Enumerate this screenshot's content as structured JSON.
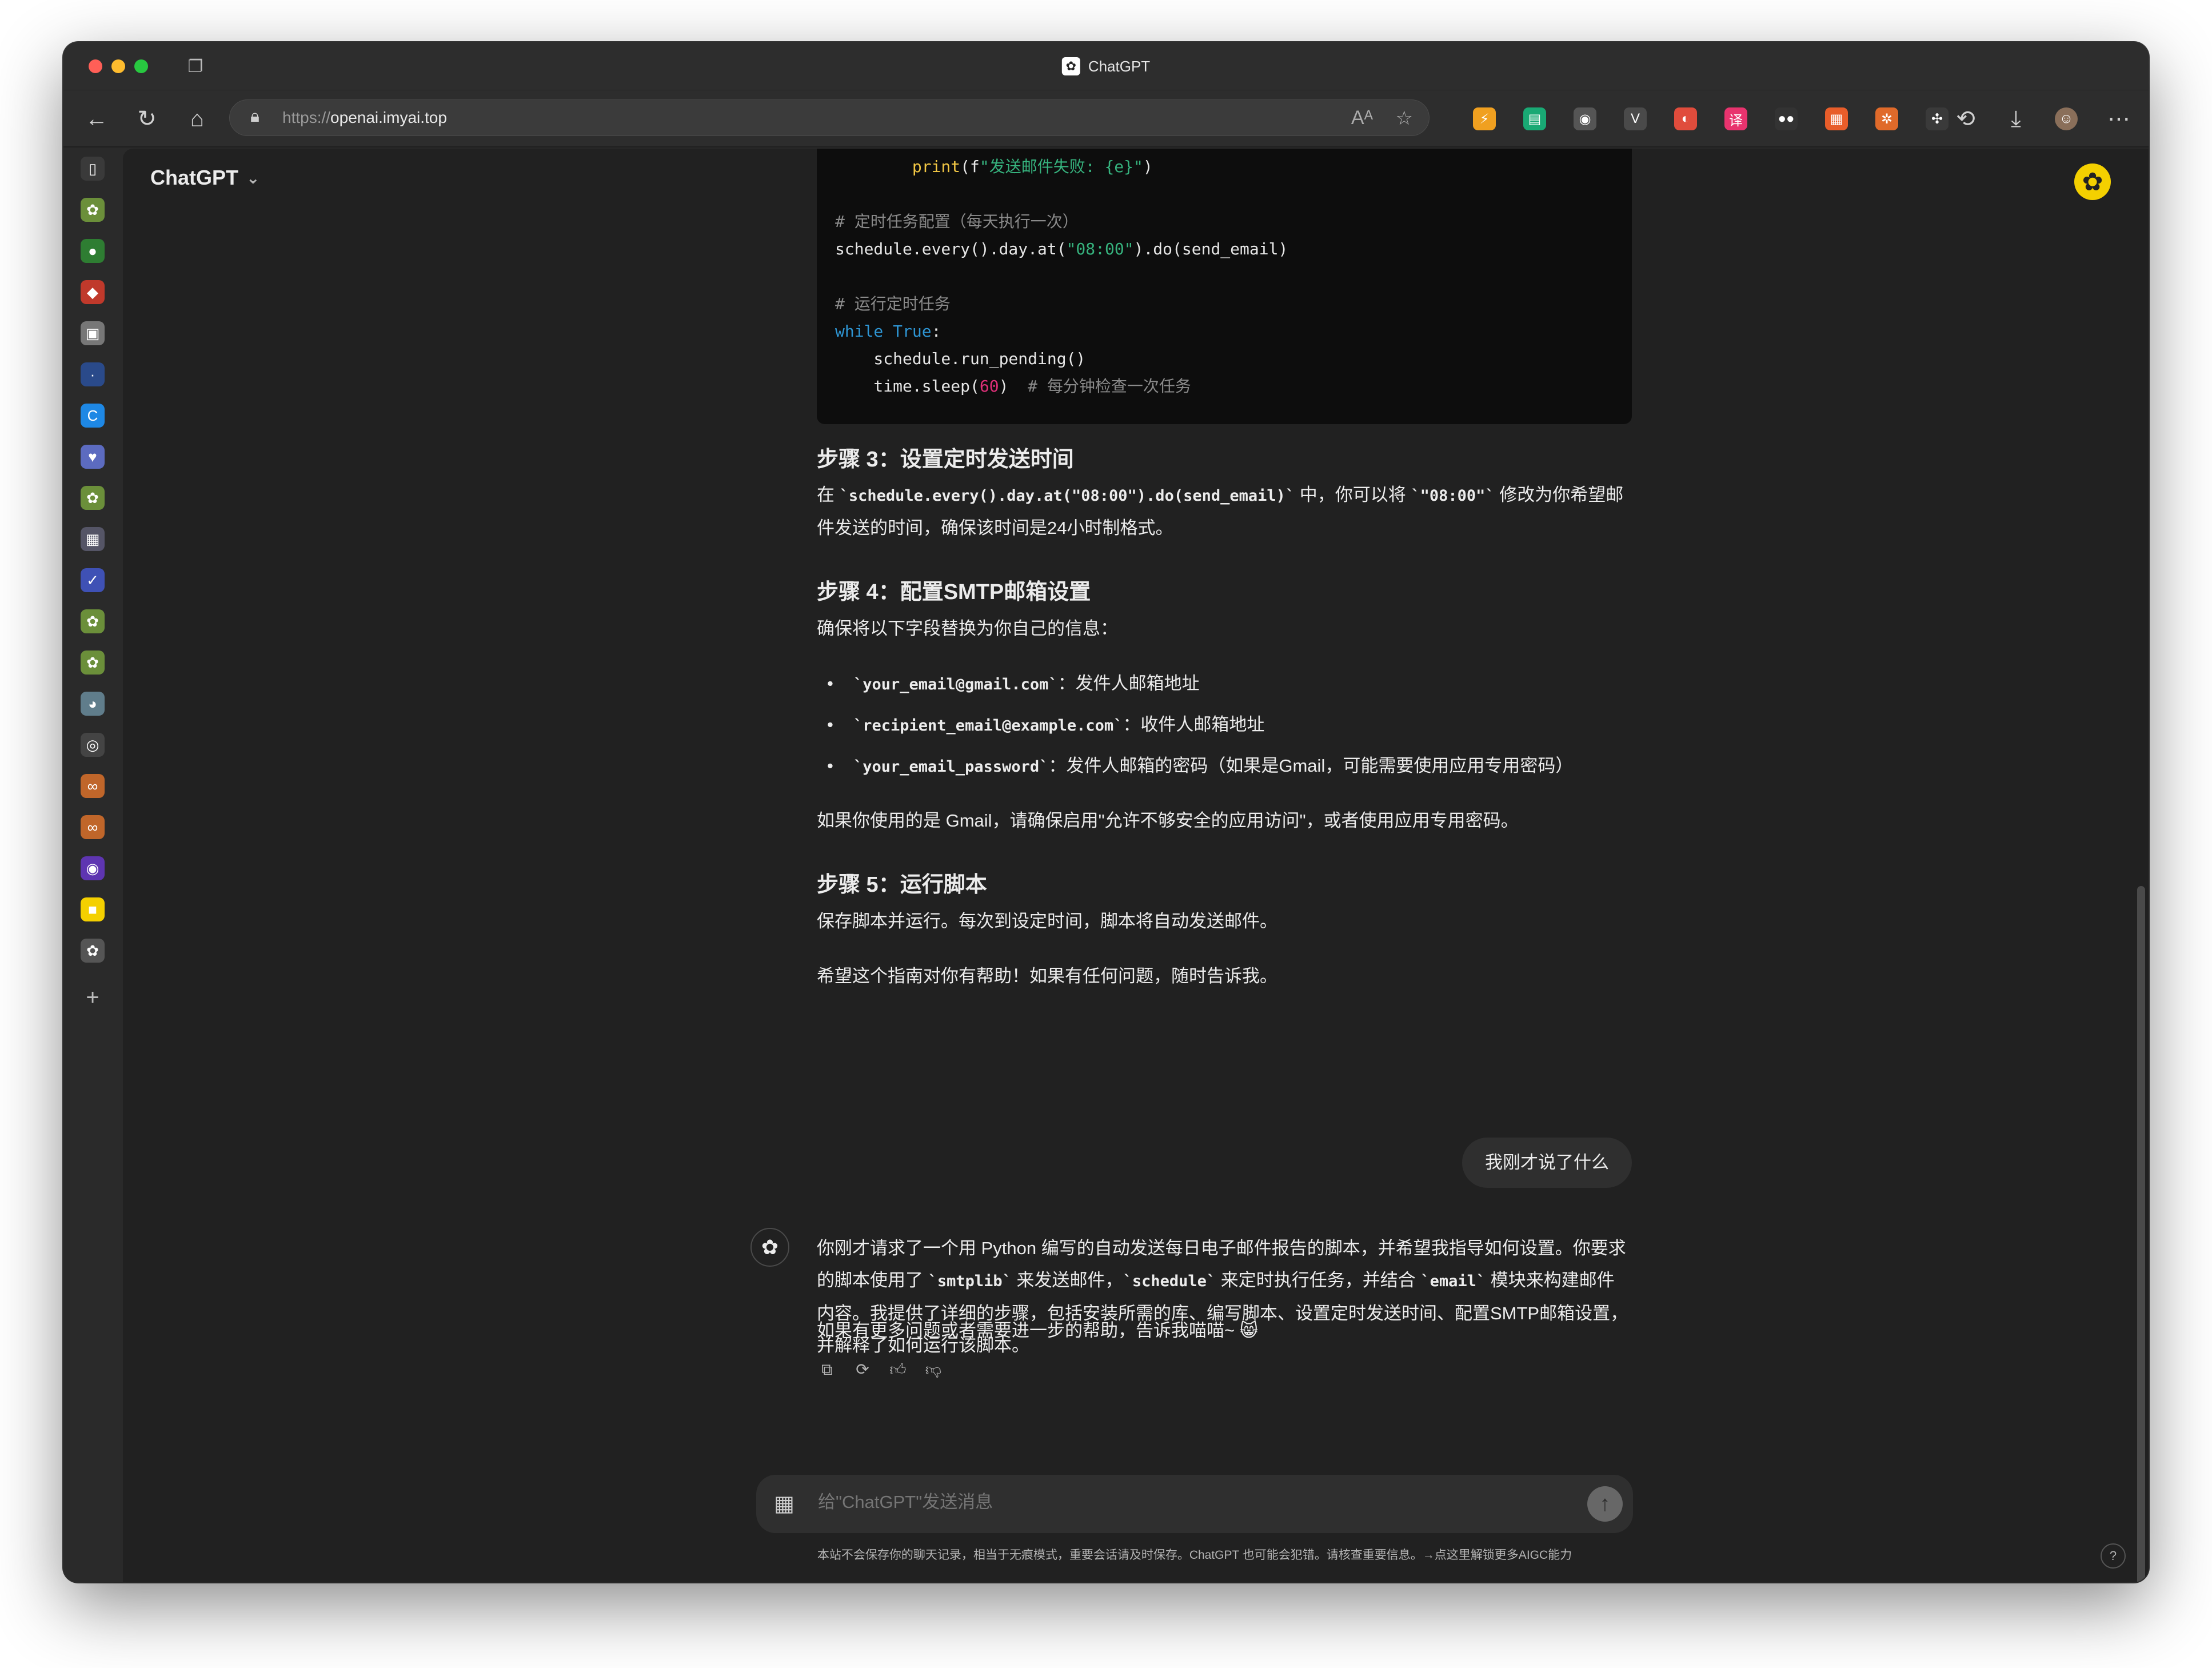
{
  "browser": {
    "tab_title": "ChatGPT",
    "url_scheme": "https://",
    "url_host": "openai.imyai.top",
    "traffic_colors": [
      "#ff5f57",
      "#febc2e",
      "#28c840"
    ]
  },
  "extensions": [
    {
      "icon": "ext-orange-icon",
      "color": "#f0a020",
      "glyph": "⚡"
    },
    {
      "icon": "ext-green-icon",
      "color": "#19a974",
      "glyph": "▤"
    },
    {
      "icon": "ext-glasses-icon",
      "color": "#555555",
      "glyph": "◉"
    },
    {
      "icon": "ext-vue-icon",
      "color": "#4a4a4a",
      "glyph": "V"
    },
    {
      "icon": "ext-chrome-icon",
      "color": "#e04c3c",
      "glyph": "◐"
    },
    {
      "icon": "ext-translate-icon",
      "color": "#e8336e",
      "glyph": "译"
    },
    {
      "icon": "ext-dots-icon",
      "color": "#333333",
      "glyph": "●●"
    },
    {
      "icon": "ext-boxes-icon",
      "color": "#e85d2a",
      "glyph": "▦"
    },
    {
      "icon": "ext-gear-orange-icon",
      "color": "#e06a2a",
      "glyph": "✲"
    },
    {
      "icon": "extensions-puzzle-icon",
      "color": "#3a3a3a",
      "glyph": "✣"
    }
  ],
  "sidebar_icons": [
    "sidebar-toggle-icon",
    "chatgpt-icon",
    "leaf-icon",
    "app-red-icon",
    "image-icon",
    "dot-icon",
    "copilot-icon",
    "heart-icon",
    "chatgpt-icon",
    "grid-icon",
    "check-icon",
    "chatgpt-icon",
    "chatgpt-icon",
    "blue-circle-icon",
    "github-icon",
    "link-icon",
    "link-icon",
    "purple-icon",
    "sticky-note-icon",
    "chatgpt-active-icon",
    "add-icon"
  ],
  "header": {
    "model_name": "ChatGPT",
    "brand_color": "#f4d000"
  },
  "code": [
    {
      "segments": [
        {
          "t": "        ",
          "c": ""
        },
        {
          "t": "print",
          "c": "c-fn"
        },
        {
          "t": "(f",
          "c": ""
        },
        {
          "t": "\"发送邮件失败: {e}\"",
          "c": "c-str"
        },
        {
          "t": ")",
          "c": ""
        }
      ]
    },
    {
      "segments": [
        {
          "t": "",
          "c": ""
        }
      ]
    },
    {
      "segments": [
        {
          "t": "# 定时任务配置（每天执行一次）",
          "c": "c-cmt"
        }
      ]
    },
    {
      "segments": [
        {
          "t": "schedule.every().day.at(",
          "c": ""
        },
        {
          "t": "\"08:00\"",
          "c": "c-str"
        },
        {
          "t": ").do(send_email)",
          "c": ""
        }
      ]
    },
    {
      "segments": [
        {
          "t": "",
          "c": ""
        }
      ]
    },
    {
      "segments": [
        {
          "t": "# 运行定时任务",
          "c": "c-cmt"
        }
      ]
    },
    {
      "segments": [
        {
          "t": "while",
          "c": "c-kw"
        },
        {
          "t": " ",
          "c": ""
        },
        {
          "t": "True",
          "c": "c-kw"
        },
        {
          "t": ":",
          "c": ""
        }
      ]
    },
    {
      "segments": [
        {
          "t": "    schedule.run_pending()",
          "c": ""
        }
      ]
    },
    {
      "segments": [
        {
          "t": "    time.sleep(",
          "c": ""
        },
        {
          "t": "60",
          "c": "c-num"
        },
        {
          "t": ")  ",
          "c": ""
        },
        {
          "t": "# 每分钟检查一次任务",
          "c": "c-cmt"
        }
      ]
    }
  ],
  "step3": {
    "title": "步骤 3：设置定时发送时间",
    "p_prefix": "在 ",
    "p_code1": "`schedule.every().day.at(\"08:00\").do(send_email)`",
    "p_mid": " 中，你可以将 ",
    "p_code2": "`\"08:00\"`",
    "p_suffix": " 修改为你希望邮件发送的时间，确保该时间是24小时制格式。"
  },
  "step4": {
    "title": "步骤 4：配置SMTP邮箱设置",
    "intro": "确保将以下字段替换为你自己的信息：",
    "bullets": [
      {
        "code": "`your_email@gmail.com`",
        "text": "：发件人邮箱地址"
      },
      {
        "code": "`recipient_email@example.com`",
        "text": "：收件人邮箱地址"
      },
      {
        "code": "`your_email_password`",
        "text": "：发件人邮箱的密码（如果是Gmail，可能需要使用应用专用密码）"
      }
    ],
    "note": "如果你使用的是 Gmail，请确保启用\"允许不够安全的应用访问\"，或者使用应用专用密码。"
  },
  "step5": {
    "title": "步骤 5：运行脚本",
    "text": "保存脚本并运行。每次到设定时间，脚本将自动发送邮件。",
    "closing": "希望这个指南对你有帮助！如果有任何问题，随时告诉我。"
  },
  "user_message": "我刚才说了什么",
  "assistant_reply": {
    "p1_a": "你刚才请求了一个用 Python 编写的自动发送每日电子邮件报告的脚本，并希望我指导如何设置。你要求的脚本使用了 ",
    "p1_code1": "`smtplib`",
    "p1_b": " 来发送邮件，",
    "p1_code2": "`schedule`",
    "p1_c": " 来定时执行任务，并结合 ",
    "p1_code3": "`email`",
    "p1_d": " 模块来构建邮件内容。我提供了详细的步骤，包括安装所需的库、编写脚本、设置定时发送时间、配置SMTP邮箱设置，并解释了如何运行该脚本。",
    "p2": "如果有更多问题或者需要进一步的帮助，告诉我喵喵~ 😸"
  },
  "composer": {
    "placeholder": "给\"ChatGPT\"发送消息"
  },
  "footer_note": "本站不会保存你的聊天记录，相当于无痕模式，重要会话请及时保存。ChatGPT 也可能会犯错。请核查重要信息。→点这里解锁更多AIGC能力",
  "help_label": "?"
}
